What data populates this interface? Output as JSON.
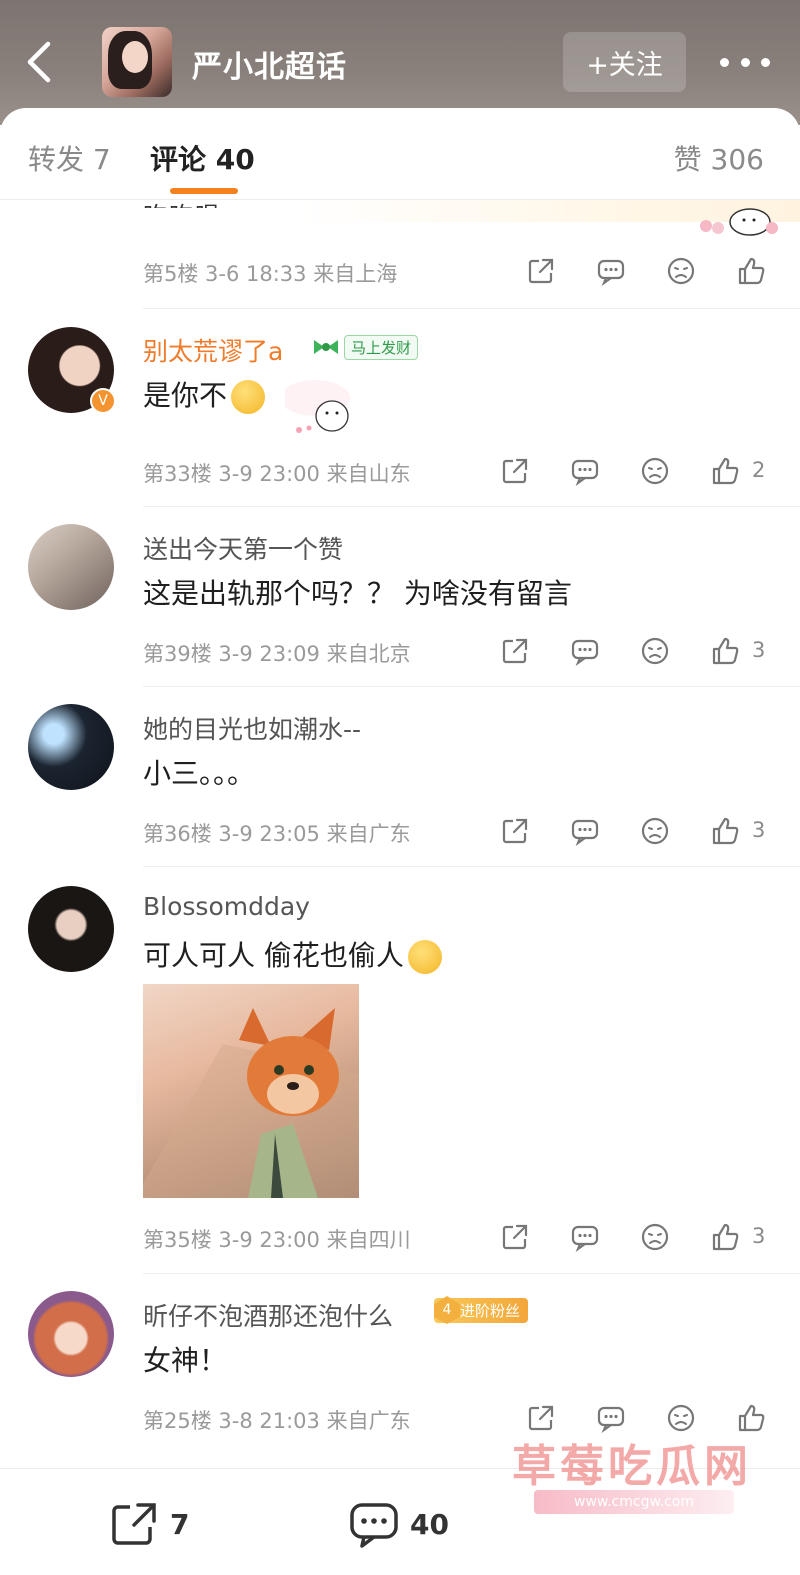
{
  "header": {
    "title": "严小北超话",
    "follow_label": "+关注"
  },
  "tabs": {
    "repost": "转发 7",
    "comment": "评论 40",
    "like": "赞 306"
  },
  "partial_comment": {
    "cut_text": "吃吃喝",
    "meta": "第5楼 3-6 18:33 来自上海"
  },
  "comments": [
    {
      "username": "别太荒谬了a",
      "badge": "马上发财",
      "text": "是你不",
      "meta": "第33楼 3-9 23:00 来自山东",
      "likes": "2"
    },
    {
      "username": "送出今天第一个赞",
      "text": "这是出轨那个吗？？ 为啥没有留言",
      "meta": "第39楼 3-9 23:09 来自北京",
      "likes": "3"
    },
    {
      "username": "她的目光也如潮水--",
      "text": "小三。。。",
      "meta": "第36楼 3-9 23:05 来自广东",
      "likes": "3"
    },
    {
      "username": "Blossomdday",
      "text": "可人可人 偷花也偷人",
      "meta": "第35楼 3-9 23:00 来自四川",
      "likes": "3"
    },
    {
      "username": "昕仔不泡酒那还泡什么",
      "badge_level": "4",
      "badge": "进阶粉丝",
      "text": "女神！",
      "meta": "第25楼 3-8 21:03 来自广东"
    }
  ],
  "bottom_bar": {
    "repost_count": "7",
    "comment_count": "40"
  },
  "watermark": {
    "text": "草莓吃瓜网",
    "url": "www.cmcgw.com"
  },
  "colors": {
    "accent": "#f5821f",
    "username_highlight": "#f07b2a",
    "meta_gray": "#9a9a9a"
  }
}
